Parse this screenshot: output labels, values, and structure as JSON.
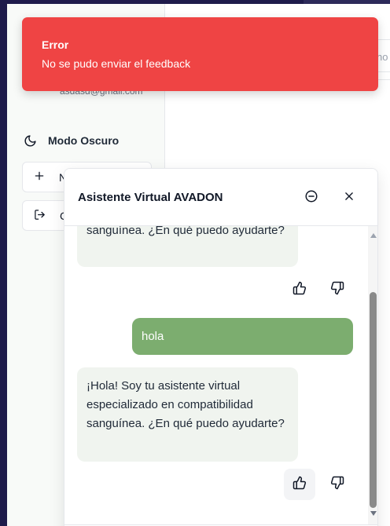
{
  "sidebar": {
    "email": "asdasd@gmail.com",
    "dark_mode_label": "Modo Oscuro",
    "icons": {
      "dark_mode": "moon-icon",
      "new": "plus-icon",
      "logout": "logout-icon"
    },
    "buttons": [
      {
        "label": "N",
        "icon": "plus-icon"
      },
      {
        "label": "C",
        "icon": "logout-icon"
      }
    ]
  },
  "main": {
    "input_placeholder": "no"
  },
  "toast": {
    "title": "Error",
    "message": "No se pudo enviar el feedback",
    "color": "#ef4444"
  },
  "chat": {
    "title": "Asistente Virtual AVADON",
    "header_icons": {
      "minimize": "minus-circle-icon",
      "close": "close-icon"
    },
    "messages": [
      {
        "role": "assistant",
        "visible_text": "sanguínea. ¿En qué puedo ayudarte?"
      },
      {
        "role": "user",
        "text": "hola"
      },
      {
        "role": "assistant",
        "text": "¡Hola! Soy tu asistente virtual especializado en compatibilidad sanguínea. ¿En qué puedo ayudarte?"
      }
    ],
    "feedback_icons": {
      "like": "thumbs-up-icon",
      "dislike": "thumbs-down-icon"
    },
    "colors": {
      "user_bubble": "#7cad6f",
      "bot_bubble": "#f0f4ef"
    }
  }
}
